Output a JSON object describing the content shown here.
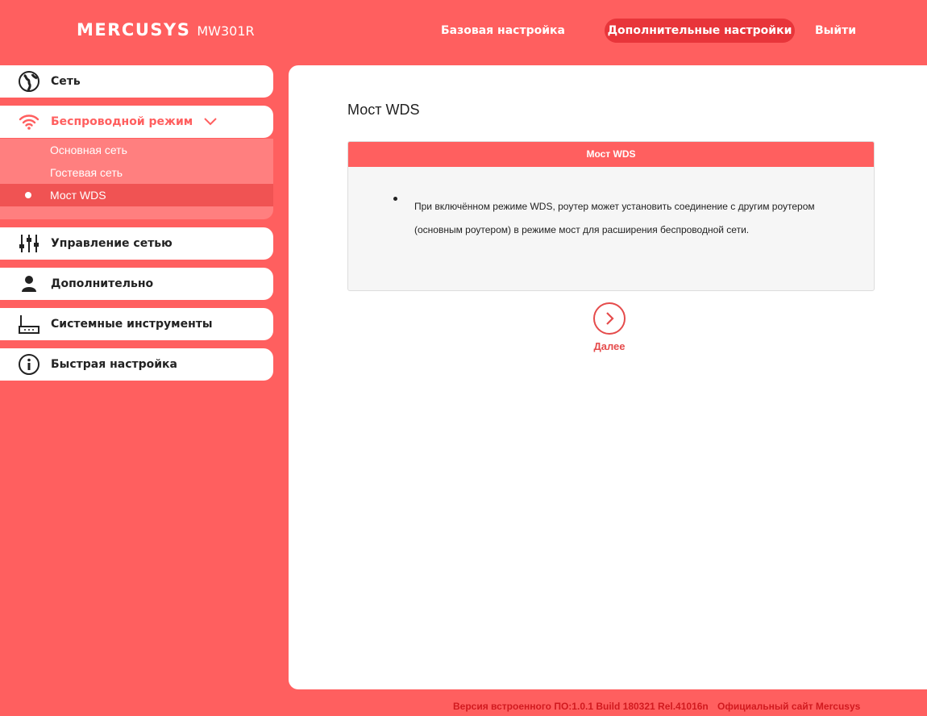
{
  "header": {
    "brand": "MERCUSYS",
    "model": "MW301R",
    "nav": {
      "basic": "Базовая настройка",
      "advanced": "Дополнительные настройки",
      "logout": "Выйти"
    }
  },
  "sidebar": {
    "items": [
      {
        "label": "Сеть",
        "icon": "globe-icon"
      },
      {
        "label": "Беспроводной режим",
        "icon": "wifi-icon"
      },
      {
        "label": "Управление сетью",
        "icon": "sliders-icon"
      },
      {
        "label": "Дополнительно",
        "icon": "user-icon"
      },
      {
        "label": "Системные инструменты",
        "icon": "router-icon"
      },
      {
        "label": "Быстрая настройка",
        "icon": "info-icon"
      }
    ],
    "wireless_submenu": [
      {
        "label": "Основная сеть"
      },
      {
        "label": "Гостевая сеть"
      },
      {
        "label": "Мост WDS"
      }
    ]
  },
  "main": {
    "title": "Мост WDS",
    "card": {
      "header": "Мост WDS",
      "text": "При включённом режиме WDS, роутер может установить соединение с другим роутером (основным роутером) в режиме мост для расширения беспроводной сети."
    },
    "next_label": "Далее"
  },
  "footer": {
    "firmware": "Версия встроенного ПО:1.0.1 Build 180321 Rel.41016n",
    "site": "Официальный сайт Mercusys"
  },
  "colors": {
    "background": "#ff5f5f",
    "accent_dark": "#e8353a",
    "submenu": "#ff7f7f",
    "submenu_selected": "#f05353",
    "footer_text": "#d11a1f"
  }
}
